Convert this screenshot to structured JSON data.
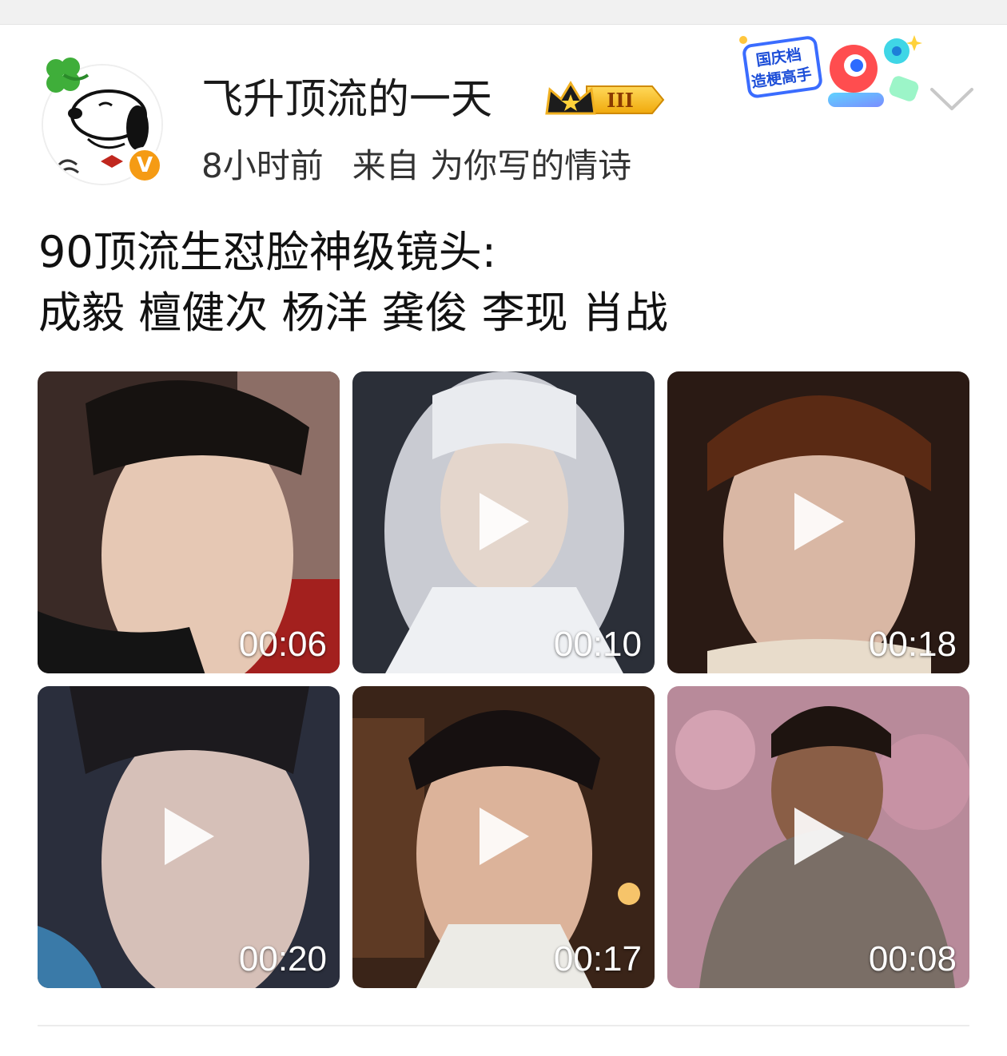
{
  "user": {
    "name": "飞升顶流的一天",
    "level_badge": "III",
    "verified_mark": "V",
    "avatar_icon": "snoopy-avatar"
  },
  "meta": {
    "time": "8小时前",
    "source": "来自 为你写的情诗"
  },
  "promo_badge": {
    "text_line1": "国庆档",
    "text_line2": "造梗高手"
  },
  "post": {
    "line1": "90顶流生怼脸神级镜头:",
    "line2": "成毅  檀健次 杨洋 龚俊 李现 肖战"
  },
  "videos": [
    {
      "duration": "00:06",
      "palette": [
        "#3a2a26",
        "#e6c8b4"
      ]
    },
    {
      "duration": "00:10",
      "palette": [
        "#2b2f38",
        "#d8d9de"
      ]
    },
    {
      "duration": "00:18",
      "palette": [
        "#2a1a14",
        "#d9b7a4"
      ]
    },
    {
      "duration": "00:20",
      "palette": [
        "#2a2e3c",
        "#d6c0b8"
      ]
    },
    {
      "duration": "00:17",
      "palette": [
        "#3a2418",
        "#dcb39a"
      ]
    },
    {
      "duration": "00:08",
      "palette": [
        "#b88a9a",
        "#7a6e66"
      ]
    }
  ],
  "colors": {
    "verified": "#f59b14",
    "crown_gold": "#f3b51a",
    "divider": "#ececec"
  }
}
